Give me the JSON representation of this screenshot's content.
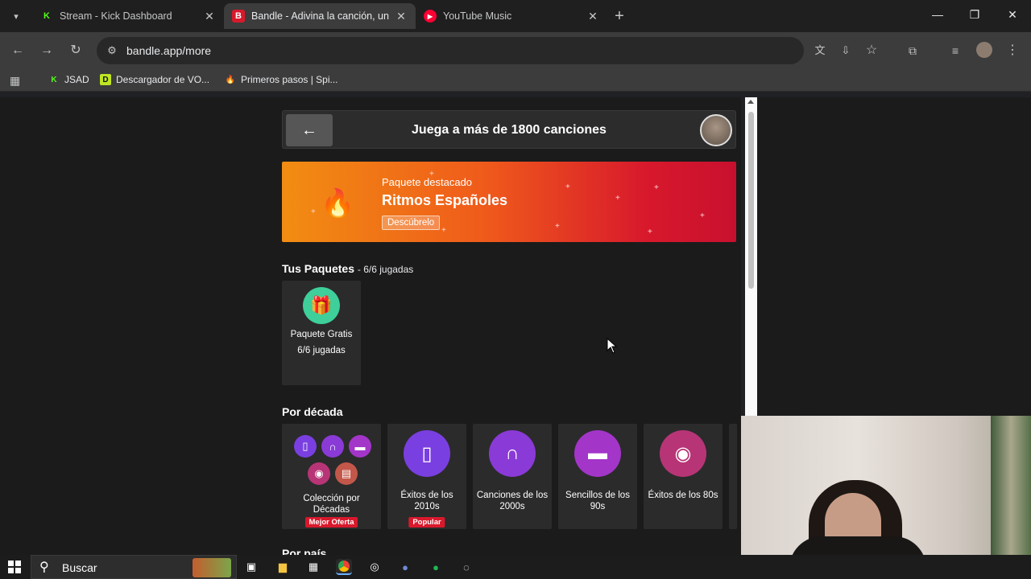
{
  "browser": {
    "tabs": [
      {
        "title": "Stream - Kick Dashboard",
        "favicon": "K",
        "active": false
      },
      {
        "title": "Bandle - Adivina la canción, un",
        "favicon": "B",
        "active": true
      },
      {
        "title": "YouTube Music",
        "favicon": "▶",
        "active": false
      }
    ],
    "url": "bandle.app/more",
    "bookmarks": [
      {
        "label": "JSAD",
        "icon": "K"
      },
      {
        "label": "Descargador de VO...",
        "icon": "D"
      },
      {
        "label": "Primeros pasos | Spi...",
        "icon": "🔥"
      }
    ]
  },
  "page": {
    "header_title": "Juega a más de 1800 canciones",
    "banner": {
      "subtitle": "Paquete destacado",
      "title": "Ritmos Españoles",
      "button": "Descúbrelo"
    },
    "your_packs": {
      "title": "Tus Paquetes",
      "count": "- 6/6 jugadas",
      "items": [
        {
          "name": "Paquete Gratis",
          "plays": "6/6 jugadas"
        }
      ]
    },
    "decades": {
      "title": "Por década",
      "items": [
        {
          "name": "Colección por Décadas",
          "badge": "Mejor Oferta"
        },
        {
          "name": "Éxitos de los 2010s",
          "badge": "Popular"
        },
        {
          "name": "Canciones de los 2000s",
          "badge": ""
        },
        {
          "name": "Sencillos de los 90s",
          "badge": ""
        },
        {
          "name": "Éxitos de los 80s",
          "badge": ""
        }
      ]
    },
    "next_section": "Por país"
  },
  "taskbar": {
    "search_label": "Buscar"
  },
  "colors": {
    "banner_start": "#f28d12",
    "banner_end": "#c8102e",
    "badge_red": "#d8192c",
    "gift_green": "#3ecf9a",
    "purple_2010": "#7a3fe0",
    "purple_2000": "#8a3ad6",
    "purple_90": "#a335c9",
    "pink_80": "#b73576"
  }
}
